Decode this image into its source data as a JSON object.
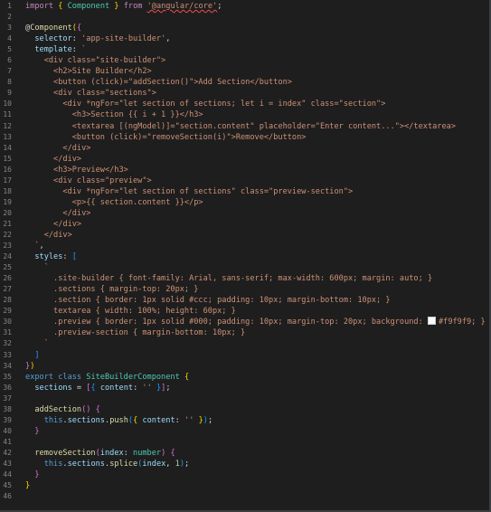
{
  "editor": {
    "theme": {
      "kw": "#c586c0",
      "blue": "#569cd6",
      "cls": "#4ec9b0",
      "str": "#ce9178",
      "fn": "#dcdcaa",
      "var": "#9cdcfe",
      "num": "#b5cea8",
      "txt": "#d4d4d4",
      "brace": "#ffd700"
    },
    "lines": [
      {
        "n": "1",
        "tokens": [
          {
            "t": "import",
            "c": "#c586c0"
          },
          {
            "t": " ",
            "c": "#d4d4d4"
          },
          {
            "t": "{",
            "c": "#ffd700"
          },
          {
            "t": " ",
            "c": "#d4d4d4"
          },
          {
            "t": "Component",
            "c": "#4ec9b0"
          },
          {
            "t": " ",
            "c": "#d4d4d4"
          },
          {
            "t": "}",
            "c": "#ffd700"
          },
          {
            "t": " from ",
            "c": "#c586c0"
          },
          {
            "t": "'@angular/core'",
            "c": "#ce9178",
            "sq": true
          },
          {
            "t": ";",
            "c": "#d4d4d4"
          }
        ]
      },
      {
        "n": "2",
        "tokens": []
      },
      {
        "n": "3",
        "tokens": [
          {
            "t": "@",
            "c": "#d4d4d4"
          },
          {
            "t": "Component",
            "c": "#dcdcaa"
          },
          {
            "t": "(",
            "c": "#ffd700"
          },
          {
            "t": "{",
            "c": "#da70d6"
          }
        ]
      },
      {
        "n": "4",
        "tokens": [
          {
            "t": "  selector",
            "c": "#9cdcfe"
          },
          {
            "t": ": ",
            "c": "#d4d4d4"
          },
          {
            "t": "'app-site-builder'",
            "c": "#ce9178"
          },
          {
            "t": ",",
            "c": "#d4d4d4"
          }
        ]
      },
      {
        "n": "5",
        "tokens": [
          {
            "t": "  template",
            "c": "#9cdcfe"
          },
          {
            "t": ": ",
            "c": "#d4d4d4"
          },
          {
            "t": "`",
            "c": "#ce9178"
          }
        ]
      },
      {
        "n": "6",
        "tokens": [
          {
            "t": "    <div class=\"site-builder\">",
            "c": "#ce9178"
          }
        ]
      },
      {
        "n": "7",
        "tokens": [
          {
            "t": "      <h2>Site Builder</h2>",
            "c": "#ce9178"
          }
        ]
      },
      {
        "n": "8",
        "tokens": [
          {
            "t": "      <button (click)=\"addSection()\">Add Section</button>",
            "c": "#ce9178"
          }
        ]
      },
      {
        "n": "9",
        "tokens": [
          {
            "t": "      <div class=\"sections\">",
            "c": "#ce9178"
          }
        ]
      },
      {
        "n": "10",
        "tokens": [
          {
            "t": "        <div *ngFor=\"let section of sections; let i = index\" class=\"section\">",
            "c": "#ce9178"
          }
        ]
      },
      {
        "n": "11",
        "tokens": [
          {
            "t": "          <h3>Section {{ i + 1 }}</h3>",
            "c": "#ce9178"
          }
        ]
      },
      {
        "n": "12",
        "tokens": [
          {
            "t": "          <textarea [(ngModel)]=\"section.content\" placeholder=\"Enter content...\"></textarea>",
            "c": "#ce9178"
          }
        ]
      },
      {
        "n": "13",
        "tokens": [
          {
            "t": "          <button (click)=\"removeSection(i)\">Remove</button>",
            "c": "#ce9178"
          }
        ]
      },
      {
        "n": "14",
        "tokens": [
          {
            "t": "        </div>",
            "c": "#ce9178"
          }
        ]
      },
      {
        "n": "15",
        "tokens": [
          {
            "t": "      </div>",
            "c": "#ce9178"
          }
        ]
      },
      {
        "n": "16",
        "tokens": [
          {
            "t": "      <h3>Preview</h3>",
            "c": "#ce9178"
          }
        ]
      },
      {
        "n": "17",
        "tokens": [
          {
            "t": "      <div class=\"preview\">",
            "c": "#ce9178"
          }
        ]
      },
      {
        "n": "18",
        "tokens": [
          {
            "t": "        <div *ngFor=\"let section of sections\" class=\"preview-section\">",
            "c": "#ce9178"
          }
        ]
      },
      {
        "n": "19",
        "tokens": [
          {
            "t": "          <p>{{ section.content }}</p>",
            "c": "#ce9178"
          }
        ]
      },
      {
        "n": "20",
        "tokens": [
          {
            "t": "        </div>",
            "c": "#ce9178"
          }
        ]
      },
      {
        "n": "21",
        "tokens": [
          {
            "t": "      </div>",
            "c": "#ce9178"
          }
        ]
      },
      {
        "n": "22",
        "tokens": [
          {
            "t": "    </div>",
            "c": "#ce9178"
          }
        ]
      },
      {
        "n": "23",
        "tokens": [
          {
            "t": "  `",
            "c": "#ce9178"
          },
          {
            "t": ",",
            "c": "#d4d4d4"
          }
        ]
      },
      {
        "n": "24",
        "tokens": [
          {
            "t": "  styles",
            "c": "#9cdcfe"
          },
          {
            "t": ": ",
            "c": "#d4d4d4"
          },
          {
            "t": "[",
            "c": "#179fff"
          }
        ]
      },
      {
        "n": "25",
        "tokens": [
          {
            "t": "    `",
            "c": "#ce9178"
          }
        ]
      },
      {
        "n": "26",
        "tokens": [
          {
            "t": "      .site-builder { font-family: Arial, sans-serif; max-width: 600px; margin: auto; }",
            "c": "#ce9178"
          }
        ]
      },
      {
        "n": "27",
        "tokens": [
          {
            "t": "      .sections { margin-top: 20px; }",
            "c": "#ce9178"
          }
        ]
      },
      {
        "n": "28",
        "tokens": [
          {
            "t": "      .section { border: 1px solid #ccc; padding: 10px; margin-bottom: 10px; }",
            "c": "#ce9178"
          }
        ]
      },
      {
        "n": "29",
        "tokens": [
          {
            "t": "      textarea { width: 100%; height: 60px; }",
            "c": "#ce9178"
          }
        ]
      },
      {
        "n": "30",
        "tokens": [
          {
            "t": "      .preview { border: 1px solid #000; padding: 10px; margin-top: 20px; background: ",
            "c": "#ce9178"
          },
          {
            "t": "#f9f9f9; }",
            "c": "#ce9178",
            "swatch": true
          }
        ]
      },
      {
        "n": "31",
        "tokens": [
          {
            "t": "      .preview-section { margin-bottom: 10px; }",
            "c": "#ce9178"
          }
        ]
      },
      {
        "n": "32",
        "tokens": [
          {
            "t": "    `",
            "c": "#ce9178"
          }
        ]
      },
      {
        "n": "33",
        "tokens": [
          {
            "t": "  ",
            "c": "#d4d4d4"
          },
          {
            "t": "]",
            "c": "#179fff"
          }
        ]
      },
      {
        "n": "34",
        "tokens": [
          {
            "t": "}",
            "c": "#da70d6"
          },
          {
            "t": ")",
            "c": "#ffd700"
          }
        ]
      },
      {
        "n": "35",
        "tokens": [
          {
            "t": "export class ",
            "c": "#569cd6"
          },
          {
            "t": "SiteBuilderComponent",
            "c": "#4ec9b0"
          },
          {
            "t": " ",
            "c": "#d4d4d4"
          },
          {
            "t": "{",
            "c": "#ffd700"
          }
        ]
      },
      {
        "n": "36",
        "tokens": [
          {
            "t": "  sections",
            "c": "#9cdcfe"
          },
          {
            "t": " = ",
            "c": "#d4d4d4"
          },
          {
            "t": "[",
            "c": "#da70d6"
          },
          {
            "t": "{",
            "c": "#179fff"
          },
          {
            "t": " content",
            "c": "#9cdcfe"
          },
          {
            "t": ": ",
            "c": "#d4d4d4"
          },
          {
            "t": "''",
            "c": "#ce9178"
          },
          {
            "t": " ",
            "c": "#d4d4d4"
          },
          {
            "t": "}",
            "c": "#179fff"
          },
          {
            "t": "]",
            "c": "#da70d6"
          },
          {
            "t": ";",
            "c": "#d4d4d4"
          }
        ]
      },
      {
        "n": "37",
        "tokens": []
      },
      {
        "n": "38",
        "tokens": [
          {
            "t": "  addSection",
            "c": "#dcdcaa"
          },
          {
            "t": "(",
            "c": "#da70d6"
          },
          {
            "t": ")",
            "c": "#da70d6"
          },
          {
            "t": " ",
            "c": "#d4d4d4"
          },
          {
            "t": "{",
            "c": "#da70d6"
          }
        ]
      },
      {
        "n": "39",
        "tokens": [
          {
            "t": "    this",
            "c": "#569cd6"
          },
          {
            "t": ".",
            "c": "#d4d4d4"
          },
          {
            "t": "sections",
            "c": "#9cdcfe"
          },
          {
            "t": ".",
            "c": "#d4d4d4"
          },
          {
            "t": "push",
            "c": "#dcdcaa"
          },
          {
            "t": "(",
            "c": "#179fff"
          },
          {
            "t": "{",
            "c": "#ffd700"
          },
          {
            "t": " content",
            "c": "#9cdcfe"
          },
          {
            "t": ": ",
            "c": "#d4d4d4"
          },
          {
            "t": "''",
            "c": "#ce9178"
          },
          {
            "t": " ",
            "c": "#d4d4d4"
          },
          {
            "t": "}",
            "c": "#ffd700"
          },
          {
            "t": ")",
            "c": "#179fff"
          },
          {
            "t": ";",
            "c": "#d4d4d4"
          }
        ]
      },
      {
        "n": "40",
        "tokens": [
          {
            "t": "  ",
            "c": "#d4d4d4"
          },
          {
            "t": "}",
            "c": "#da70d6"
          }
        ]
      },
      {
        "n": "41",
        "tokens": []
      },
      {
        "n": "42",
        "tokens": [
          {
            "t": "  removeSection",
            "c": "#dcdcaa"
          },
          {
            "t": "(",
            "c": "#da70d6"
          },
          {
            "t": "index",
            "c": "#9cdcfe"
          },
          {
            "t": ": ",
            "c": "#d4d4d4"
          },
          {
            "t": "number",
            "c": "#4ec9b0"
          },
          {
            "t": ")",
            "c": "#da70d6"
          },
          {
            "t": " ",
            "c": "#d4d4d4"
          },
          {
            "t": "{",
            "c": "#da70d6"
          }
        ]
      },
      {
        "n": "43",
        "tokens": [
          {
            "t": "    this",
            "c": "#569cd6"
          },
          {
            "t": ".",
            "c": "#d4d4d4"
          },
          {
            "t": "sections",
            "c": "#9cdcfe"
          },
          {
            "t": ".",
            "c": "#d4d4d4"
          },
          {
            "t": "splice",
            "c": "#dcdcaa"
          },
          {
            "t": "(",
            "c": "#179fff"
          },
          {
            "t": "index",
            "c": "#9cdcfe"
          },
          {
            "t": ", ",
            "c": "#d4d4d4"
          },
          {
            "t": "1",
            "c": "#b5cea8"
          },
          {
            "t": ")",
            "c": "#179fff"
          },
          {
            "t": ";",
            "c": "#d4d4d4"
          }
        ]
      },
      {
        "n": "44",
        "tokens": [
          {
            "t": "  ",
            "c": "#d4d4d4"
          },
          {
            "t": "}",
            "c": "#da70d6"
          }
        ]
      },
      {
        "n": "45",
        "tokens": [
          {
            "t": "}",
            "c": "#ffd700"
          }
        ]
      },
      {
        "n": "46",
        "tokens": []
      }
    ]
  }
}
